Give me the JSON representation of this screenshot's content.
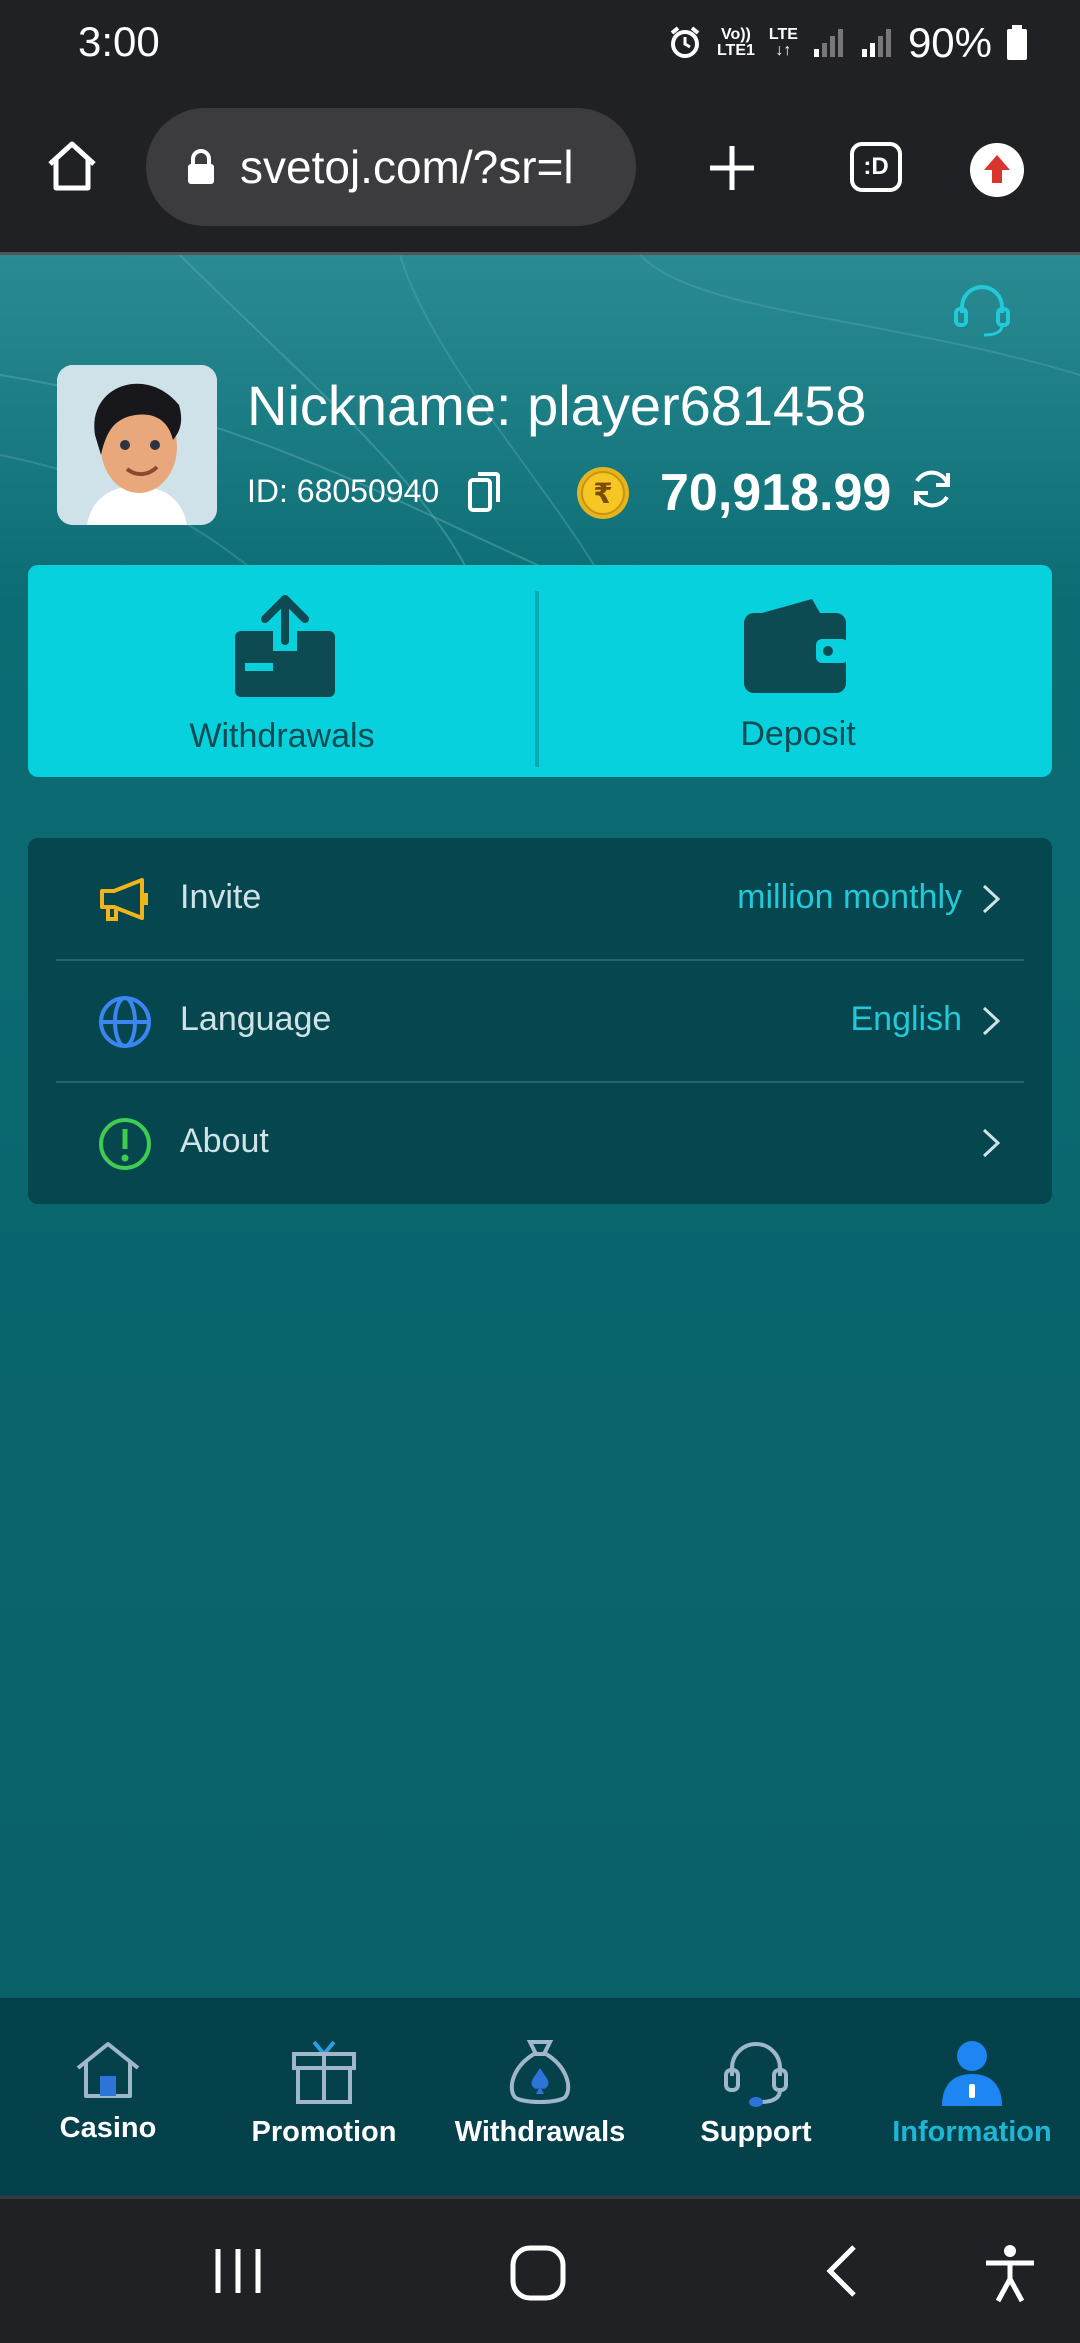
{
  "status_bar": {
    "time": "3:00",
    "network_top": "Vo))",
    "network_bottom": "LTE1",
    "lte": "LTE",
    "battery": "90%"
  },
  "browser": {
    "url": "svetoj.com/?sr=l",
    "tab_label": ":D"
  },
  "profile": {
    "nickname": "Nickname: player681458",
    "id": "ID: 68050940",
    "currency_symbol": "₹",
    "balance": "70,918.99"
  },
  "actions": {
    "withdrawals": "Withdrawals",
    "deposit": "Deposit"
  },
  "menu": [
    {
      "label": "Invite",
      "value": "million monthly",
      "icon": "megaphone-icon",
      "color": "#f0b51c"
    },
    {
      "label": "Language",
      "value": "English",
      "icon": "globe-icon",
      "color": "#3b86f0"
    },
    {
      "label": "About",
      "value": "",
      "icon": "info-icon",
      "color": "#3fcd4f"
    }
  ],
  "tabs": [
    {
      "label": "Casino",
      "icon": "home-icon",
      "active": false
    },
    {
      "label": "Promotion",
      "icon": "gift-icon",
      "active": false
    },
    {
      "label": "Withdrawals",
      "icon": "money-bag-icon",
      "active": false
    },
    {
      "label": "Support",
      "icon": "headset-icon",
      "active": false
    },
    {
      "label": "Information",
      "icon": "person-icon",
      "active": true
    }
  ],
  "colors": {
    "accent": "#06d1dc",
    "active_tab": "#1fb6d6",
    "menu_value": "#22c9d8"
  }
}
